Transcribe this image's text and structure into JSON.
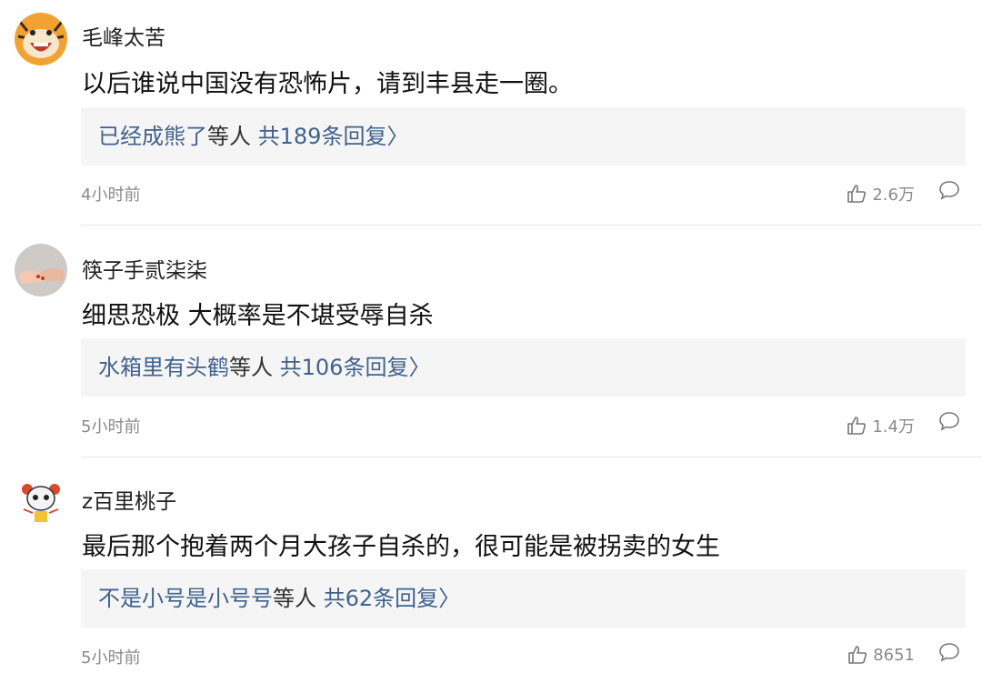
{
  "comments": [
    {
      "username": "毛峰太苦",
      "text": "以后谁说中国没有恐怖片，请到丰县走一圈。",
      "reply_user": "已经成熊了",
      "reply_mid": "等人",
      "reply_count": "共189条回复",
      "chevron": "〉",
      "time": "4小时前",
      "likes": "2.6万",
      "avatar_icon": "tiger-avatar-icon"
    },
    {
      "username": "筷子手贰柒柒",
      "text": "细思恐极 大概率是不堪受辱自杀",
      "reply_user": "水箱里有头鹤",
      "reply_mid": "等人",
      "reply_count": "共106条回复",
      "chevron": "〉",
      "time": "5小时前",
      "likes": "1.4万",
      "avatar_icon": "holding-hands-avatar-icon"
    },
    {
      "username": "z百里桃子",
      "text": "最后那个抱着两个月大孩子自杀的，很可能是被拐卖的女生",
      "reply_user": "不是小号是小号号",
      "reply_mid": "等人",
      "reply_count": "共62条回复",
      "chevron": "〉",
      "time": "5小时前",
      "likes": "8651",
      "avatar_icon": "cartoon-panda-avatar-icon"
    }
  ]
}
